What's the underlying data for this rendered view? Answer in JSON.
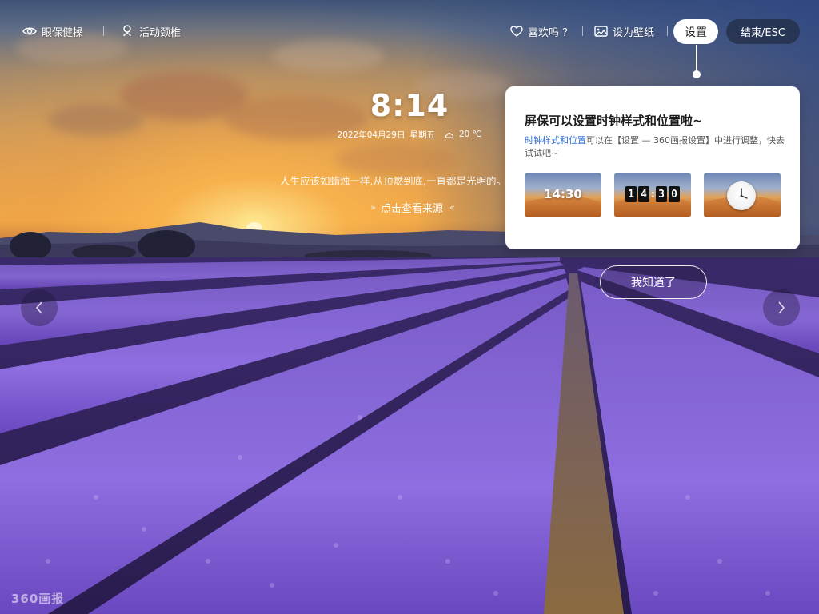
{
  "toolbar": {
    "eye_care_label": "眼保健操",
    "activity_label": "活动颈椎",
    "like_label": "喜欢吗 ？",
    "set_wallpaper_label": "设为壁纸",
    "settings_label": "设置",
    "exit_label": "结束/ESC"
  },
  "clock": {
    "time": "8:14",
    "date": "2022年04月29日",
    "weekday": "星期五",
    "weather": "20 ℃"
  },
  "quote": "人生应该如蜡烛一样,从顶燃到底,一直都是光明的。",
  "source_link_label": "点击查看来源",
  "tip": {
    "title": "屏保可以设置时钟样式和位置啦~",
    "desc_highlight": "时钟样式和位置",
    "desc_rest": "可以在【设置 — 360画报设置】中进行调整，快去试试吧~",
    "thumb1_time": "14:30",
    "thumb2_digits": [
      "1",
      "4",
      "3",
      "0"
    ]
  },
  "got_it_label": "我知道了",
  "logo_text": "360画报"
}
